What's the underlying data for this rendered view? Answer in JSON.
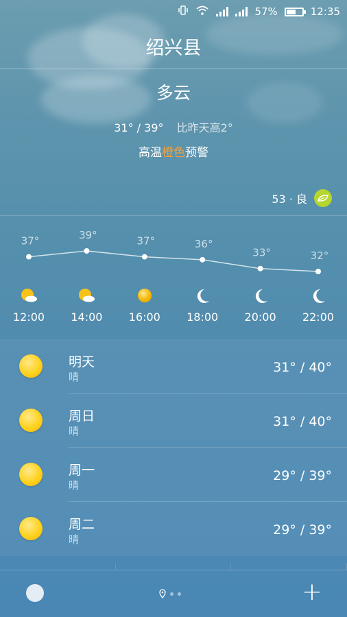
{
  "status_bar": {
    "battery": "57%",
    "time": "12:35",
    "icons": [
      "vibrate-icon",
      "wifi-icon",
      "signal-icon",
      "signal-icon",
      "battery-icon"
    ]
  },
  "location": {
    "city": "绍兴县"
  },
  "current": {
    "condition": "多云",
    "range": "31° / 39°",
    "compare": "比昨天高2°",
    "alert_prefix": "高温",
    "alert_color_word": "橙色",
    "alert_suffix": "预警",
    "alert_color": "#f2a240"
  },
  "aqi": {
    "value": "53 · 良",
    "badge_color": "#b6d52f",
    "icon": "leaf-icon"
  },
  "hourly": [
    {
      "time": "12:00",
      "temp": "37°",
      "value": 37,
      "icon": "partly-cloudy-icon"
    },
    {
      "time": "14:00",
      "temp": "39°",
      "value": 39,
      "icon": "partly-cloudy-icon"
    },
    {
      "time": "16:00",
      "temp": "37°",
      "value": 37,
      "icon": "sun-icon"
    },
    {
      "time": "18:00",
      "temp": "36°",
      "value": 36,
      "icon": "moon-icon"
    },
    {
      "time": "20:00",
      "temp": "33°",
      "value": 33,
      "icon": "moon-icon"
    },
    {
      "time": "22:00",
      "temp": "32°",
      "value": 32,
      "icon": "moon-icon"
    }
  ],
  "daily": [
    {
      "day": "明天",
      "desc": "晴",
      "range": "31° / 40°",
      "icon": "sun-icon"
    },
    {
      "day": "周日",
      "desc": "晴",
      "range": "31° / 40°",
      "icon": "sun-icon"
    },
    {
      "day": "周一",
      "desc": "晴",
      "range": "29° / 39°",
      "icon": "sun-icon"
    },
    {
      "day": "周二",
      "desc": "晴",
      "range": "29° / 39°",
      "icon": "sun-icon"
    }
  ],
  "bottom_bar": {
    "add_label": "+",
    "page_count": 3,
    "current_page": 0
  }
}
